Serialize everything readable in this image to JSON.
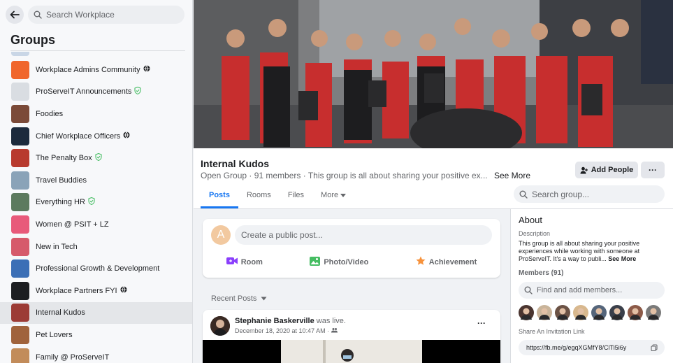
{
  "sidebar": {
    "search_placeholder": "Search Workplace",
    "title": "Groups",
    "items": [
      {
        "label": "Workplace Admins Community",
        "thumb_color": "#f0662c",
        "badge": "globe"
      },
      {
        "label": "ProServeIT Announcements",
        "thumb_color": "#d9dde2",
        "badge": "shield"
      },
      {
        "label": "Foodies",
        "thumb_color": "#7b4a38",
        "badge": ""
      },
      {
        "label": "Chief Workplace Officers",
        "thumb_color": "#1c2a3c",
        "badge": "globe"
      },
      {
        "label": "The Penalty Box",
        "thumb_color": "#b83a2e",
        "badge": "shield"
      },
      {
        "label": "Travel Buddies",
        "thumb_color": "#8aa3b8",
        "badge": ""
      },
      {
        "label": "Everything HR",
        "thumb_color": "#5c7a5e",
        "badge": "shield"
      },
      {
        "label": "Women @ PSIT + LZ",
        "thumb_color": "#e85a7a",
        "badge": ""
      },
      {
        "label": "New in Tech",
        "thumb_color": "#d65a6b",
        "badge": ""
      },
      {
        "label": "Professional Growth & Development",
        "thumb_color": "#3b6fb6",
        "badge": ""
      },
      {
        "label": "Workplace Partners FYI",
        "thumb_color": "#1c1e21",
        "badge": "globe"
      },
      {
        "label": "Internal Kudos",
        "thumb_color": "#9c3b35",
        "badge": "",
        "active": true
      },
      {
        "label": "Pet Lovers",
        "thumb_color": "#a0633c",
        "badge": ""
      },
      {
        "label": "Family @ ProServeIT",
        "thumb_color": "#c28c5a",
        "badge": ""
      }
    ]
  },
  "header": {
    "group_name": "Internal Kudos",
    "meta": "Open Group · 91 members · This group is all about sharing your positive ex...",
    "see_more": "See More",
    "add_people": "Add People",
    "more": "···"
  },
  "tabs": [
    {
      "label": "Posts",
      "active": true
    },
    {
      "label": "Rooms"
    },
    {
      "label": "Files"
    },
    {
      "label": "More"
    }
  ],
  "group_search_placeholder": "Search group...",
  "composer": {
    "avatar_letter": "A",
    "placeholder": "Create a public post...",
    "actions": [
      {
        "label": "Room",
        "icon": "video-camera-icon",
        "color": "#8a3ffc"
      },
      {
        "label": "Photo/Video",
        "icon": "photo-icon",
        "color": "#45bd62"
      },
      {
        "label": "Achievement",
        "icon": "star-icon",
        "color": "#f7923b"
      }
    ]
  },
  "recent_posts_label": "Recent Posts",
  "post": {
    "author": "Stephanie Baskerville",
    "action": "was live.",
    "date": "December 18, 2020 at 10:47 AM ·",
    "dots": "···"
  },
  "about": {
    "title": "About",
    "description_label": "Description",
    "description": "This group is all about sharing your positive experiences while working with someone at ProServeIT. It's a way to publi...",
    "see_more": "See More",
    "members_label": "Members (91)",
    "find_members_placeholder": "Find and add members...",
    "member_colors": [
      "#4a3530",
      "#c9b49a",
      "#6b5245",
      "#d8b88e",
      "#55657a",
      "#3a3f4a",
      "#8c5a48",
      "#7a7a7a"
    ],
    "invite_label": "Share An Invitation Link",
    "invite_link": "https://fb.me/g/egqXGMfY8/ClTi5i6y"
  },
  "colors": {
    "accent": "#1877f2",
    "active_item_bg": "#e4e6e9",
    "verified_green": "#45bd62"
  }
}
